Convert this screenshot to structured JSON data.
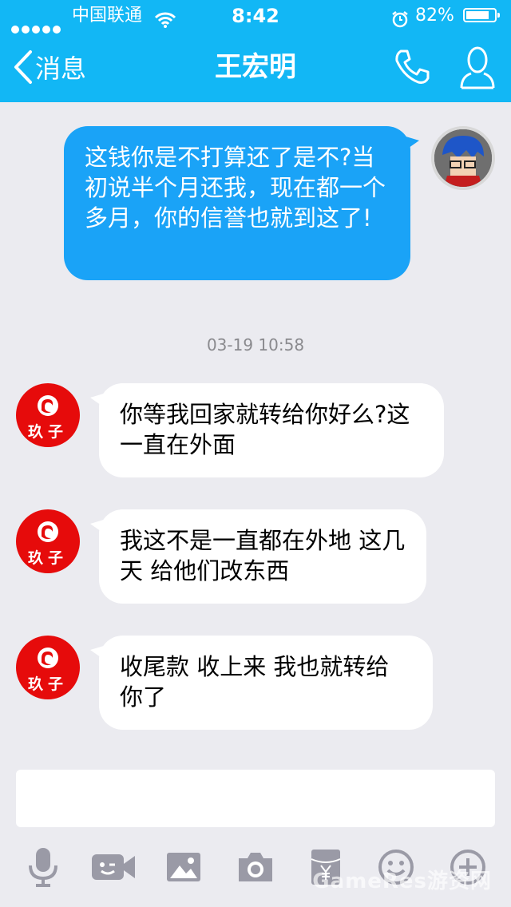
{
  "status_bar": {
    "carrier": "中国联通",
    "time": "8:42",
    "battery_pct": "82%",
    "battery_level": 0.82
  },
  "nav": {
    "back_label": "消息",
    "title": "王宏明"
  },
  "messages": [
    {
      "side": "me",
      "text": "这钱你是不打算还了是不?当初说半个月还我，现在都一个多月，你的信誉也就到这了!"
    },
    {
      "side": "other",
      "text": "你等我回家就转给你好么?这一直在外面"
    },
    {
      "side": "other",
      "text": "我这不是一直都在外地 这几天 给他们改东西"
    },
    {
      "side": "other",
      "text": "收尾款 收上来 我也就转给你了"
    }
  ],
  "timestamp": "03-19 10:58",
  "contact_avatar_text": "玖子",
  "toolbar": [
    "mic-icon",
    "video-icon",
    "image-icon",
    "camera-icon",
    "red-packet-icon",
    "emoji-icon",
    "plus-icon"
  ],
  "watermark": "GameRes游资网",
  "colors": {
    "header": "#12b7f5",
    "my_bubble": "#1aa3f7",
    "background": "#ebebf0",
    "avatar_red": "#e60b0b"
  }
}
